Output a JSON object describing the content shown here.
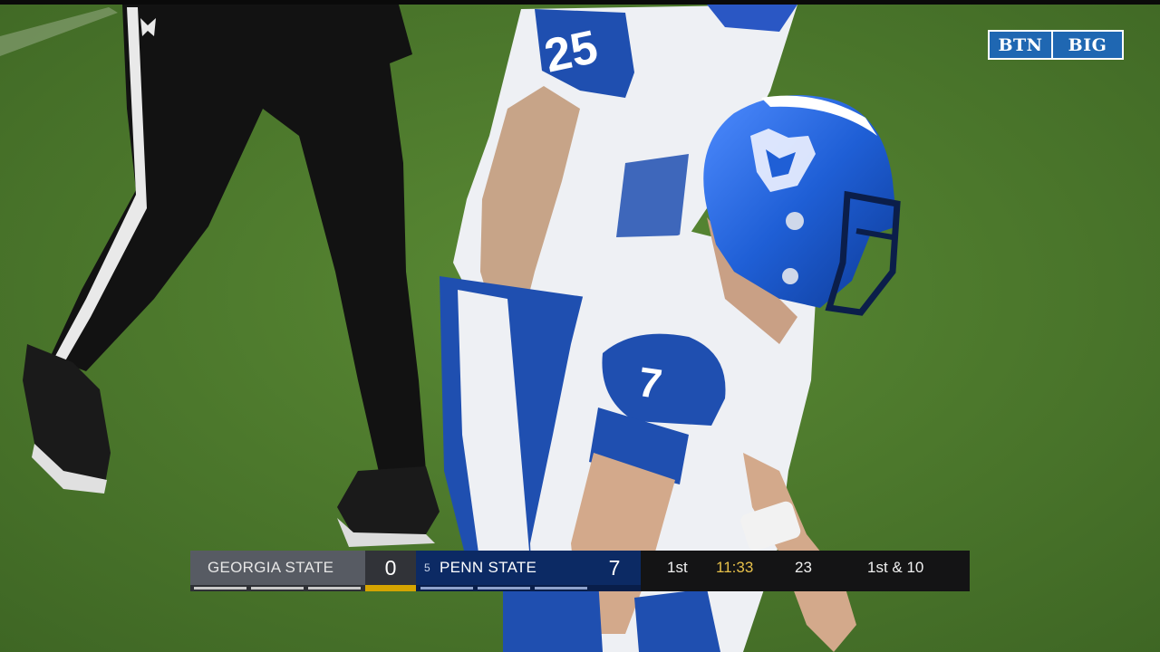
{
  "network_bug": {
    "primary": "BTN",
    "secondary": "BIG"
  },
  "scoreboard": {
    "away": {
      "name": "GEORGIA STATE",
      "score": "0"
    },
    "home": {
      "rank": "5",
      "name": "PENN STATE",
      "score": "7"
    },
    "quarter": "1st",
    "game_clock": "11:33",
    "play_clock": "23",
    "down_distance": "1st & 10"
  },
  "players": [
    {
      "team": "GEORGIA STATE",
      "number": "25"
    },
    {
      "team": "GEORGIA STATE",
      "number": "7"
    }
  ],
  "colors": {
    "field": "#4f7a2c",
    "jersey_white": "#eef0f4",
    "jersey_blue": "#1f4fb0",
    "helmet_blue": "#1f5fd6",
    "away_bar": "#575b63",
    "home_bar": "#0c2a64",
    "clock": "#e6c04a",
    "possession_gold": "#d5a400"
  }
}
